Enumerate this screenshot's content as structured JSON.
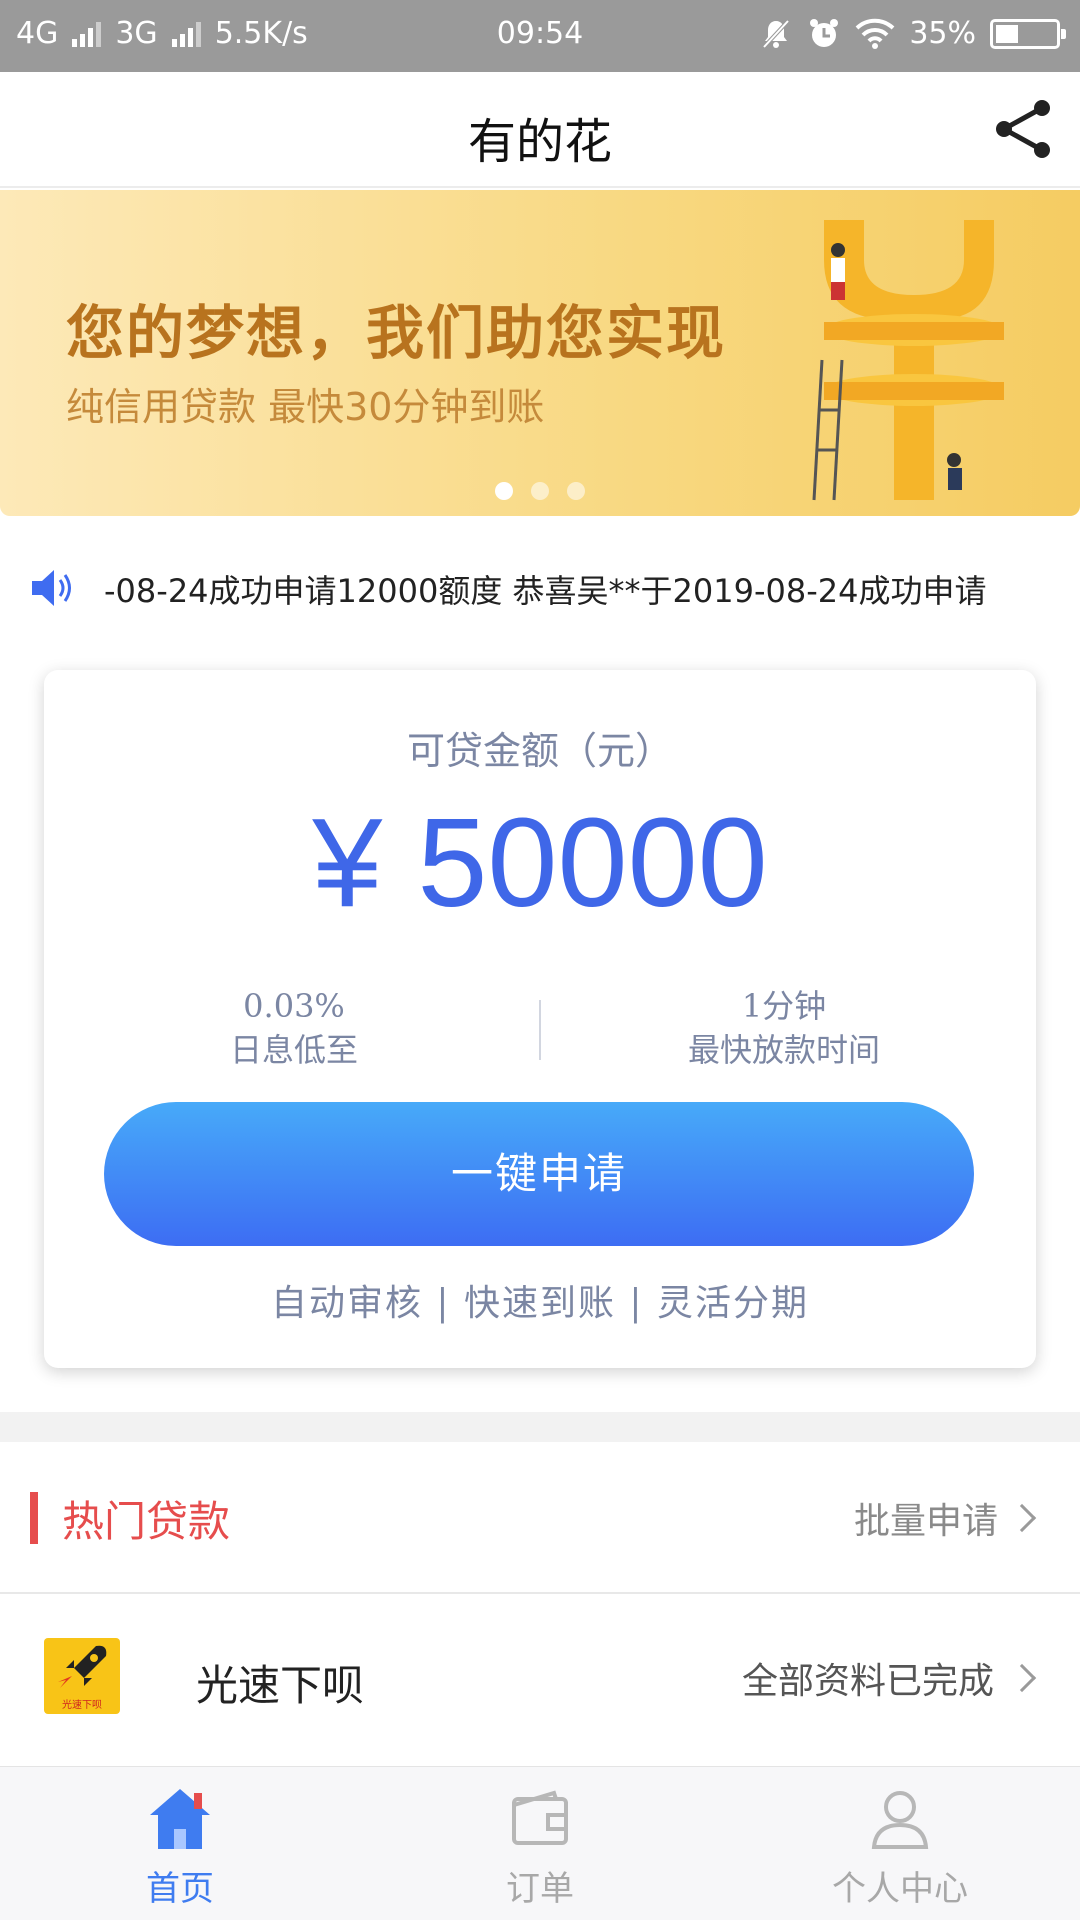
{
  "status_bar": {
    "network1": "4G",
    "network2": "3G",
    "speed": "5.5K/s",
    "time": "09:54",
    "battery": "35%"
  },
  "header": {
    "title": "有的花",
    "share_icon": "share-icon"
  },
  "banner": {
    "headline": "您的梦想，我们助您实现",
    "subline": "纯信用贷款 最快30分钟到账",
    "slide_count": 3,
    "active_slide": 1
  },
  "marquee": {
    "icon": "speaker-icon",
    "text": "-08-24成功申请12000额度   恭喜吴**于2019-08-24成功申请"
  },
  "loan_card": {
    "label": "可贷金额（元）",
    "amount": "¥ 50000",
    "stat_left_value": "0.03%",
    "stat_left_label": "日息低至",
    "stat_right_value": "1分钟",
    "stat_right_label": "最快放款时间",
    "apply_label": "一键申请",
    "features": "自动审核 | 快速到账 | 灵活分期"
  },
  "hot_loans": {
    "title": "热门贷款",
    "batch_apply": "批量申请"
  },
  "products": [
    {
      "logo_text": "光速下呗",
      "name": "光速下呗",
      "status": "全部资料已完成"
    }
  ],
  "bottom_nav": {
    "items": [
      {
        "label": "首页",
        "icon": "home-icon",
        "active": true
      },
      {
        "label": "订单",
        "icon": "wallet-icon",
        "active": false
      },
      {
        "label": "个人中心",
        "icon": "user-icon",
        "active": false
      }
    ]
  },
  "colors": {
    "accent_blue": "#3f67e8",
    "hot_red": "#e64d4d",
    "banner_gold": "#b8731e"
  }
}
